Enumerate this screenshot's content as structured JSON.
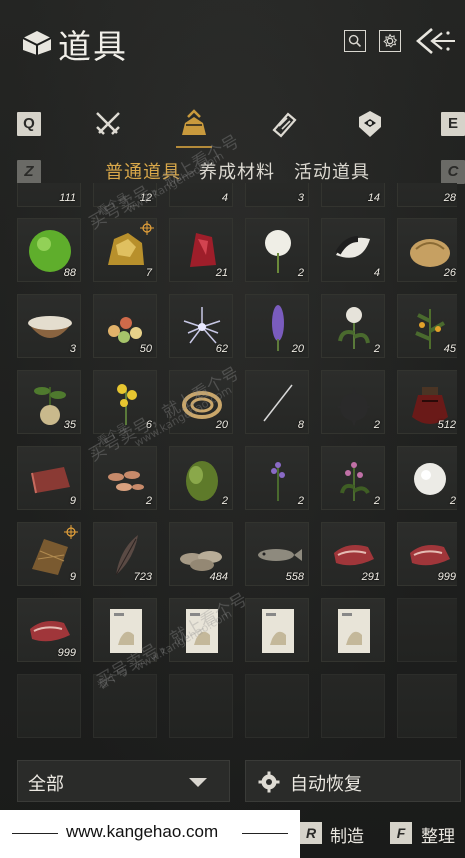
{
  "header": {
    "title": "道具"
  },
  "tabs": {
    "left_key": "Q",
    "right_key": "E",
    "icons": [
      "crossed-swords-icon",
      "item-bag-icon",
      "scroll-icon",
      "badge-icon"
    ],
    "active_index": 1
  },
  "subtabs": {
    "left_key": "Z",
    "right_key": "C",
    "items": [
      "普通道具",
      "养成材料",
      "活动道具"
    ],
    "active_index": 0
  },
  "grid": {
    "top_row_qty": [
      "111",
      "12",
      "4",
      "3",
      "14",
      "28"
    ],
    "rows": [
      [
        {
          "icon": "green-orb-icon",
          "qty": "88"
        },
        {
          "icon": "gold-ore-icon",
          "qty": "7",
          "marked": true
        },
        {
          "icon": "red-crystal-icon",
          "qty": "21"
        },
        {
          "icon": "white-flower-icon",
          "qty": "2"
        },
        {
          "icon": "feather-tuft-icon",
          "qty": "4"
        },
        {
          "icon": "bread-icon",
          "qty": "26"
        }
      ],
      [
        {
          "icon": "rice-bowl-icon",
          "qty": "3"
        },
        {
          "icon": "mixed-beans-icon",
          "qty": "50"
        },
        {
          "icon": "spiky-flower-icon",
          "qty": "62"
        },
        {
          "icon": "purple-spike-icon",
          "qty": "20"
        },
        {
          "icon": "white-rose-icon",
          "qty": "2"
        },
        {
          "icon": "berry-branch-icon",
          "qty": "45"
        }
      ],
      [
        {
          "icon": "root-herb-icon",
          "qty": "35"
        },
        {
          "icon": "yellow-flower-icon",
          "qty": "6"
        },
        {
          "icon": "rope-coil-icon",
          "qty": "20"
        },
        {
          "icon": "needle-icon",
          "qty": "8"
        },
        {
          "icon": "iron-ball-icon",
          "qty": "2"
        },
        {
          "icon": "wine-jar-icon",
          "qty": "512"
        }
      ],
      [
        {
          "icon": "raw-meat-icon",
          "qty": "9"
        },
        {
          "icon": "mushrooms-icon",
          "qty": "2"
        },
        {
          "icon": "green-bush-icon",
          "qty": "2"
        },
        {
          "icon": "lavender-icon",
          "qty": "2"
        },
        {
          "icon": "pink-herb-icon",
          "qty": "2"
        },
        {
          "icon": "snowball-icon",
          "qty": "2"
        }
      ],
      [
        {
          "icon": "straw-bundle-icon",
          "qty": "9",
          "marked": true
        },
        {
          "icon": "dark-feather-icon",
          "qty": "723"
        },
        {
          "icon": "oysters-icon",
          "qty": "484"
        },
        {
          "icon": "fish-icon",
          "qty": "558"
        },
        {
          "icon": "steak-icon",
          "qty": "291"
        },
        {
          "icon": "steak-icon",
          "qty": "999"
        }
      ],
      [
        {
          "icon": "steak-icon",
          "qty": "999"
        },
        {
          "icon": "recipe-card-icon",
          "qty": ""
        },
        {
          "icon": "recipe-card-icon",
          "qty": ""
        },
        {
          "icon": "recipe-card-icon",
          "qty": ""
        },
        {
          "icon": "recipe-card-icon",
          "qty": ""
        },
        {
          "icon": "",
          "qty": ""
        }
      ]
    ]
  },
  "footer": {
    "filter_label": "全部",
    "auto_recover_label": "自动恢复",
    "site": "www.kangehao.com",
    "actions": [
      {
        "key": "R",
        "label": "制造"
      },
      {
        "key": "F",
        "label": "整理"
      }
    ]
  },
  "watermark": {
    "text_a": "买号卖号，就上看个号",
    "text_b": "www.kangehao.com",
    "text_c": "看个号"
  }
}
